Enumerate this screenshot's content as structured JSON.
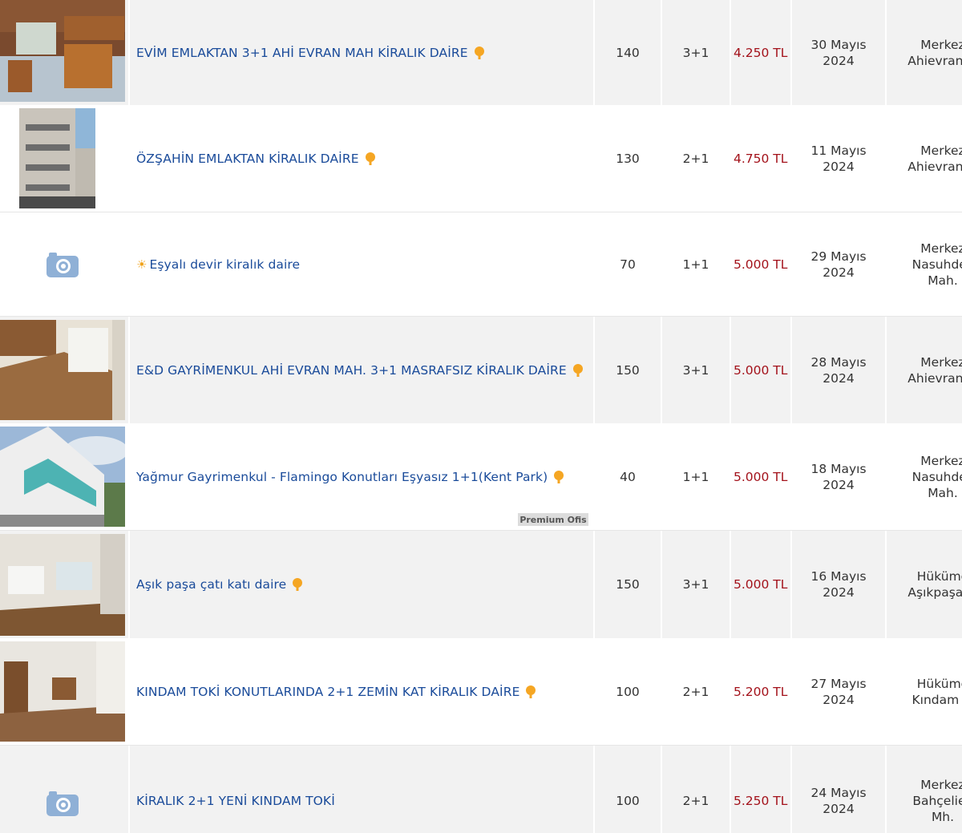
{
  "listings": [
    {
      "title": "EVİM EMLAKTAN 3+1 AHİ EVRAN MAH KİRALIK DAİRE",
      "m2": "140",
      "rooms": "3+1",
      "price": "4.250 TL",
      "date_day": "30 Mayıs",
      "date_year": "2024",
      "loc_1": "Merkez",
      "loc_2": "Ahievran M",
      "loc_3": "",
      "photo": "kitchen-photo"
    },
    {
      "title": "ÖZŞAHİN EMLAKTAN KİRALIK DAİRE",
      "m2": "130",
      "rooms": "2+1",
      "price": "4.750 TL",
      "date_day": "11 Mayıs",
      "date_year": "2024",
      "loc_1": "Merkez",
      "loc_2": "Ahievran M",
      "loc_3": "",
      "photo": "building-photo"
    },
    {
      "title": "Eşyalı devir kiralık daire",
      "m2": "70",
      "rooms": "1+1",
      "price": "5.000 TL",
      "date_day": "29 Mayıs",
      "date_year": "2024",
      "loc_1": "Merkez",
      "loc_2": "Nasuhdec",
      "loc_3": "Mah.",
      "photo": "camera-icon"
    },
    {
      "title": "E&D GAYRİMENKUL AHİ EVRAN MAH. 3+1 MASRAFSIZ KİRALIK DAİRE",
      "m2": "150",
      "rooms": "3+1",
      "price": "5.000 TL",
      "date_day": "28 Mayıs",
      "date_year": "2024",
      "loc_1": "Merkez",
      "loc_2": "Ahievran M",
      "loc_3": "",
      "photo": "room-photo"
    },
    {
      "title": "Yağmur Gayrimenkul - Flamingo Konutları Eşyasız 1+1(Kent Park)",
      "m2": "40",
      "rooms": "1+1",
      "price": "5.000 TL",
      "date_day": "18 Mayıs",
      "date_year": "2024",
      "loc_1": "Merkez",
      "loc_2": "Nasuhdec",
      "loc_3": "Mah.",
      "photo": "facade-photo",
      "badge": "Premium Ofis"
    },
    {
      "title": "Aşık paşa çatı katı daire",
      "m2": "150",
      "rooms": "3+1",
      "price": "5.000 TL",
      "date_day": "16 Mayıs",
      "date_year": "2024",
      "loc_1": "Hüküme",
      "loc_2": "Aşıkpaşa M",
      "loc_3": "",
      "photo": "empty-room-photo"
    },
    {
      "title": "KINDAM TOKİ KONUTLARINDA 2+1 ZEMİN KAT KİRALIK DAİRE",
      "m2": "100",
      "rooms": "2+1",
      "price": "5.200 TL",
      "date_day": "27 Mayıs",
      "date_year": "2024",
      "loc_1": "Hüküme",
      "loc_2": "Kındam M",
      "loc_3": "",
      "photo": "interior-photo"
    },
    {
      "title": "KİRALIK 2+1 YENİ KINDAM TOKİ",
      "m2": "100",
      "rooms": "2+1",
      "price": "5.250 TL",
      "date_day": "24 Mayıs",
      "date_year": "2024",
      "loc_1": "Merkez",
      "loc_2": "Bahçeliev",
      "loc_3": "Mh.",
      "photo": "camera-icon"
    }
  ],
  "colors": {
    "title_link": "#1a4b9a",
    "price": "#a3111a",
    "row_alt": "#f2f2f2",
    "pin": "#f5a623"
  }
}
